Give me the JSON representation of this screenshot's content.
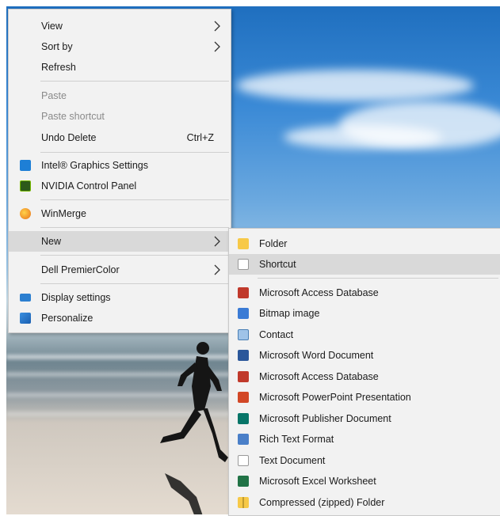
{
  "context_menu": {
    "items": [
      {
        "label": "View",
        "has_submenu": true
      },
      {
        "label": "Sort by",
        "has_submenu": true
      },
      {
        "label": "Refresh"
      },
      {
        "label": "Paste",
        "disabled": true
      },
      {
        "label": "Paste shortcut",
        "disabled": true
      },
      {
        "label": "Undo Delete",
        "shortcut": "Ctrl+Z"
      },
      {
        "label": "Intel® Graphics Settings",
        "icon": "intel-graphics-icon"
      },
      {
        "label": "NVIDIA Control Panel",
        "icon": "nvidia-icon"
      },
      {
        "label": "WinMerge",
        "icon": "winmerge-icon"
      },
      {
        "label": "New",
        "has_submenu": true,
        "highlighted": true
      },
      {
        "label": "Dell PremierColor",
        "has_submenu": true
      },
      {
        "label": "Display settings",
        "icon": "display-settings-icon"
      },
      {
        "label": "Personalize",
        "icon": "personalize-icon"
      }
    ]
  },
  "new_submenu": {
    "items": [
      {
        "label": "Folder",
        "icon": "folder-icon"
      },
      {
        "label": "Shortcut",
        "icon": "shortcut-icon",
        "highlighted": true
      },
      {
        "label": "Microsoft Access Database",
        "icon": "access-icon"
      },
      {
        "label": "Bitmap image",
        "icon": "bitmap-icon"
      },
      {
        "label": "Contact",
        "icon": "contact-icon"
      },
      {
        "label": "Microsoft Word Document",
        "icon": "word-icon"
      },
      {
        "label": "Microsoft Access Database",
        "icon": "access-icon"
      },
      {
        "label": "Microsoft PowerPoint Presentation",
        "icon": "powerpoint-icon"
      },
      {
        "label": "Microsoft Publisher Document",
        "icon": "publisher-icon"
      },
      {
        "label": "Rich Text Format",
        "icon": "rtf-icon"
      },
      {
        "label": "Text Document",
        "icon": "text-document-icon"
      },
      {
        "label": "Microsoft Excel Worksheet",
        "icon": "excel-icon"
      },
      {
        "label": "Compressed (zipped) Folder",
        "icon": "zip-folder-icon"
      }
    ]
  },
  "colors": {
    "menu_background": "#f2f2f2",
    "highlight": "#d9d9d9",
    "disabled_text": "#8a8a8a"
  }
}
